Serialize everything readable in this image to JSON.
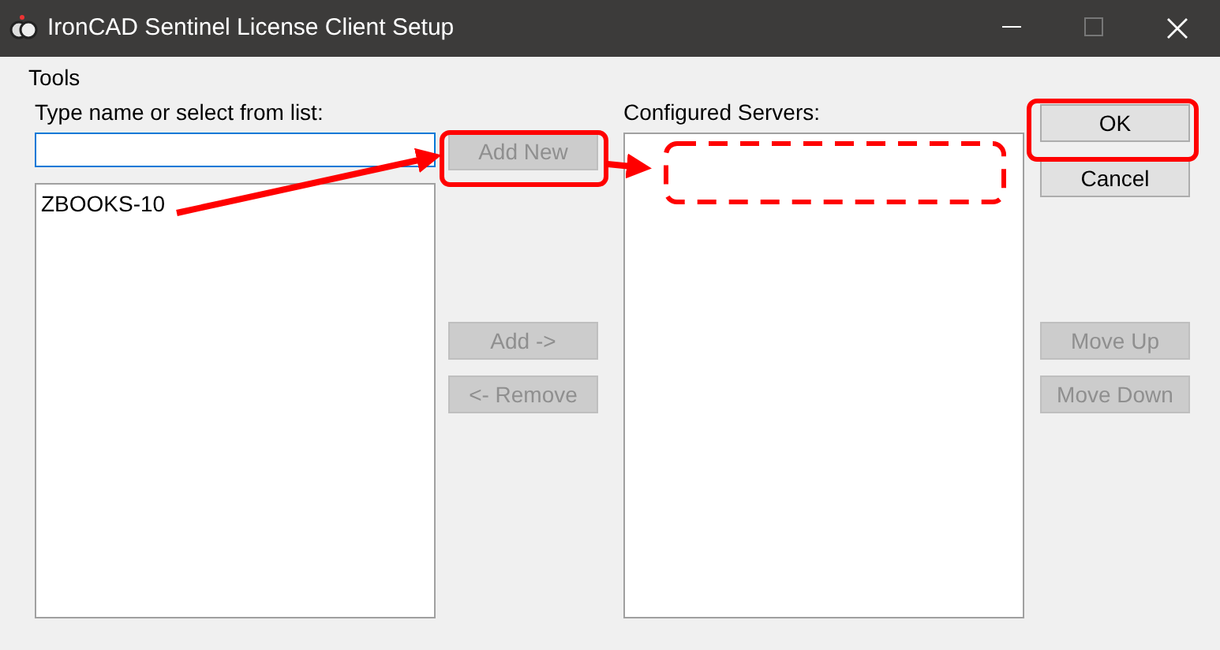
{
  "window": {
    "title": "IronCAD Sentinel License Client Setup",
    "maximize_disabled": true
  },
  "menu": [
    "Tools"
  ],
  "name_field": {
    "label": "Type name or select from list:"
  },
  "available_list": {
    "items": [
      {
        "label": "ZBOOKS-10",
        "selected": false
      }
    ]
  },
  "middle_buttons": {
    "top": [
      {
        "label": "Add New",
        "disabled": true
      }
    ],
    "bottom": [
      {
        "label": "Add ->",
        "disabled": true
      },
      {
        "label": "<- Remove",
        "disabled": true
      }
    ]
  },
  "configured_servers": {
    "label": "Configured Servers:"
  },
  "right_buttons": {
    "top": [
      {
        "label": "OK",
        "disabled": false
      },
      {
        "label": "Cancel",
        "disabled": false
      }
    ],
    "bottom": [
      {
        "label": "Move Up",
        "disabled": true
      },
      {
        "label": "Move Down",
        "disabled": true
      }
    ]
  }
}
